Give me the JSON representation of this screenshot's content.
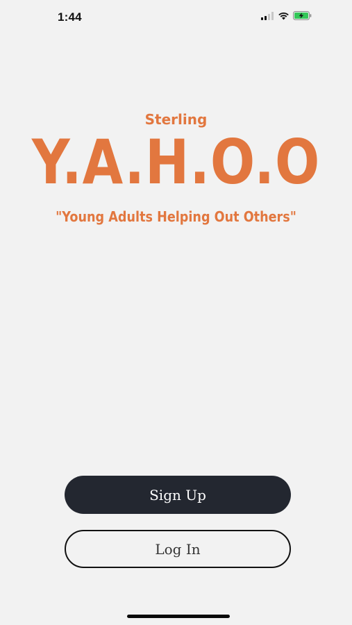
{
  "status_bar": {
    "time": "1:44",
    "icons": [
      "signal-icon",
      "wifi-icon",
      "battery-charging-icon"
    ]
  },
  "brand": {
    "sub": "Sterling",
    "title": "Y.A.H.O.O",
    "tagline": "\"Young Adults Helping Out Others\"",
    "color": "#e2773f"
  },
  "actions": {
    "signup_label": "Sign Up",
    "login_label": "Log In"
  },
  "colors": {
    "background": "#f2f2f2",
    "primary_button": "#232730",
    "battery_charging": "#34c759"
  }
}
